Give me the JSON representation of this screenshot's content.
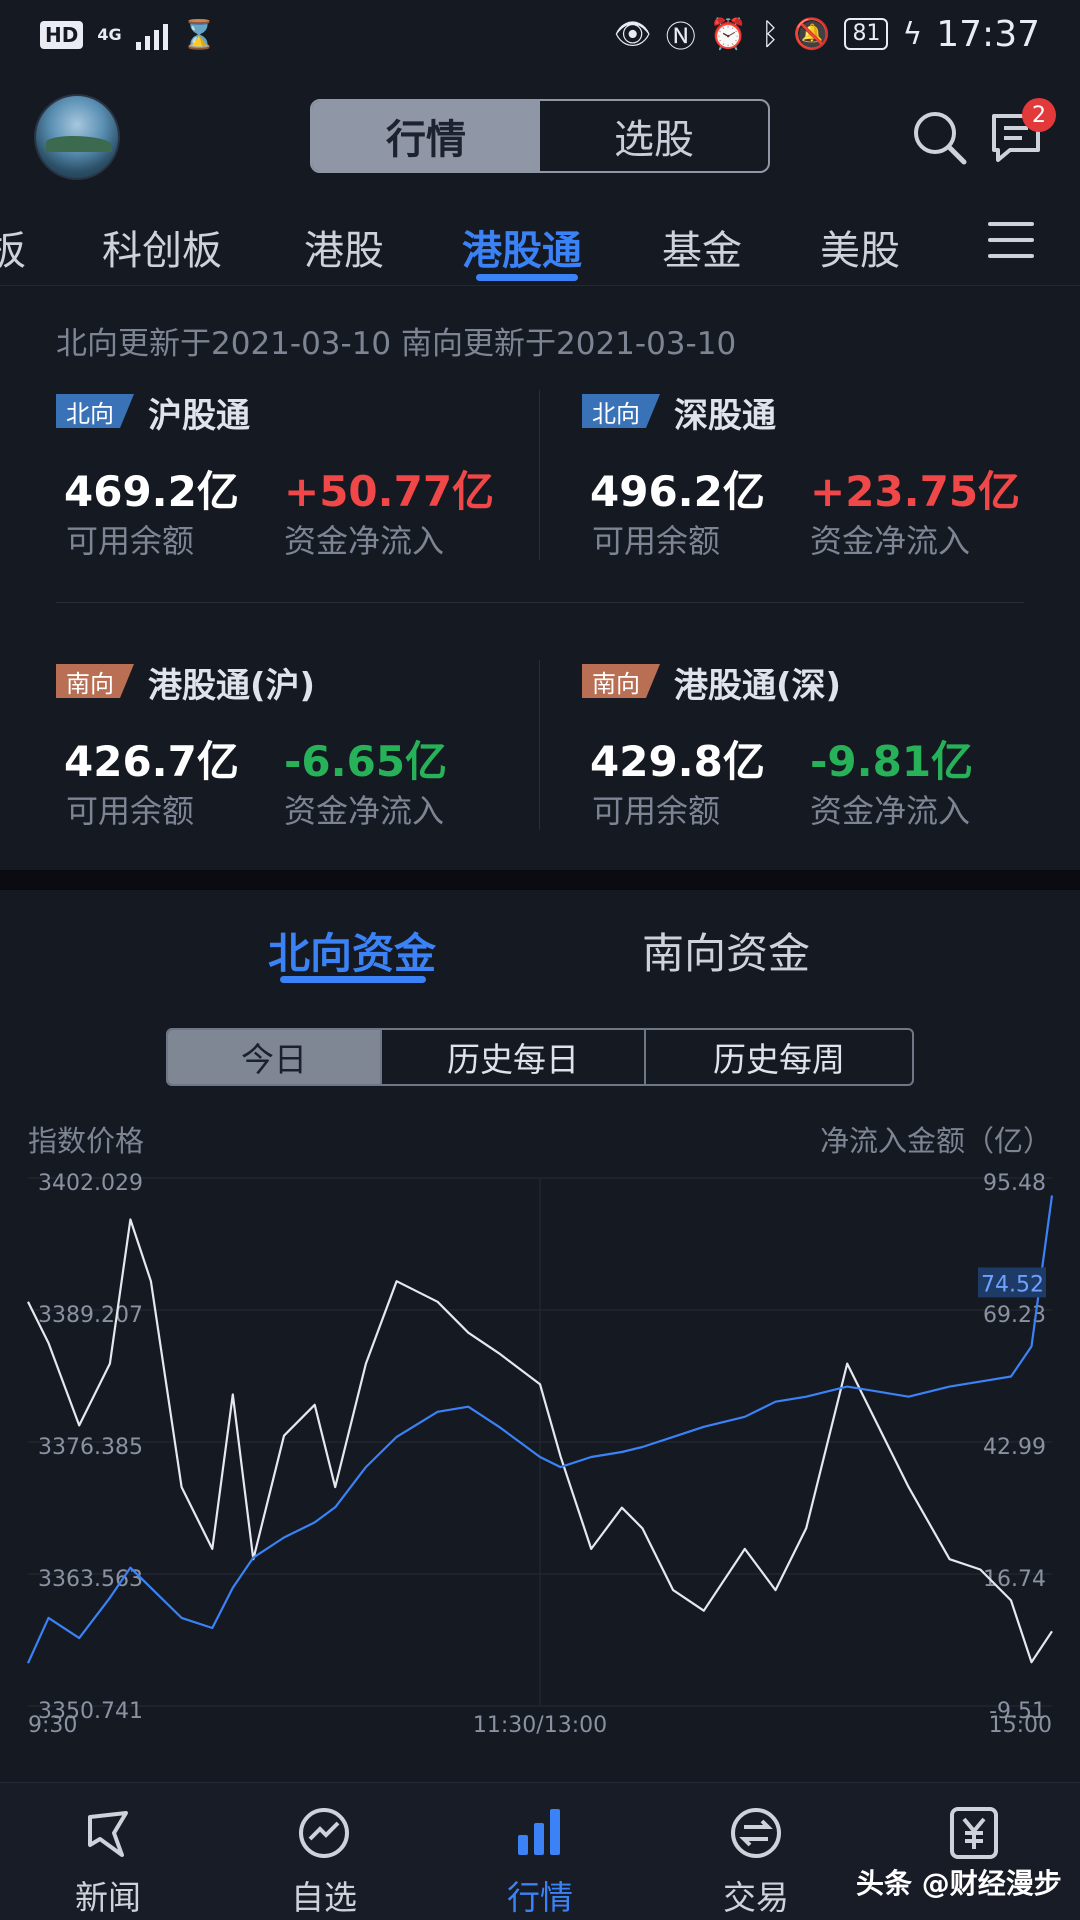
{
  "status_bar": {
    "hd": "HD",
    "network": "4G",
    "battery": "81",
    "time": "17:37"
  },
  "header": {
    "tabs": [
      {
        "label": "行情",
        "active": true
      },
      {
        "label": "选股",
        "active": false
      }
    ],
    "message_badge": "2"
  },
  "market_tabs": [
    {
      "label": "板",
      "active": false
    },
    {
      "label": "科创板",
      "active": false
    },
    {
      "label": "港股",
      "active": false
    },
    {
      "label": "港股通",
      "active": true
    },
    {
      "label": "基金",
      "active": false
    },
    {
      "label": "美股",
      "active": false
    }
  ],
  "update_line": "北向更新于2021-03-10  南向更新于2021-03-10",
  "cards": [
    {
      "tag": "北向",
      "title": "沪股通",
      "available": "469.2亿",
      "available_label": "可用余额",
      "net_flow": "+50.77亿",
      "net_flow_label": "资金净流入",
      "direction": "up"
    },
    {
      "tag": "北向",
      "title": "深股通",
      "available": "496.2亿",
      "available_label": "可用余额",
      "net_flow": "+23.75亿",
      "net_flow_label": "资金净流入",
      "direction": "up"
    },
    {
      "tag": "南向",
      "title": "港股通(沪)",
      "available": "426.7亿",
      "available_label": "可用余额",
      "net_flow": "-6.65亿",
      "net_flow_label": "资金净流入",
      "direction": "down"
    },
    {
      "tag": "南向",
      "title": "港股通(深)",
      "available": "429.8亿",
      "available_label": "可用余额",
      "net_flow": "-9.81亿",
      "net_flow_label": "资金净流入",
      "direction": "down"
    }
  ],
  "fund_tabs": [
    {
      "label": "北向资金",
      "active": true
    },
    {
      "label": "南向资金",
      "active": false
    }
  ],
  "range_tabs": [
    {
      "label": "今日",
      "active": true
    },
    {
      "label": "历史每日",
      "active": false
    },
    {
      "label": "历史每周",
      "active": false
    }
  ],
  "chart_data": {
    "type": "line",
    "ylabel_left": "指数价格",
    "ylabel_right": "净流入金额（亿）",
    "y_left_ticks": [
      "3402.029",
      "3389.207",
      "3376.385",
      "3363.563",
      "3350.741"
    ],
    "y_right_ticks": [
      "95.48",
      "69.23",
      "42.99",
      "16.74",
      "-9.51"
    ],
    "y_left_range": [
      3350.741,
      3402.029
    ],
    "y_right_range": [
      -9.51,
      95.48
    ],
    "x_ticks": [
      "9:30",
      "11:30/13:00",
      "15:00"
    ],
    "last_value_label": "74.52",
    "x": [
      0,
      0.02,
      0.05,
      0.08,
      0.1,
      0.12,
      0.15,
      0.18,
      0.2,
      0.22,
      0.25,
      0.28,
      0.3,
      0.33,
      0.36,
      0.4,
      0.43,
      0.46,
      0.5,
      0.52,
      0.55,
      0.58,
      0.6,
      0.63,
      0.66,
      0.7,
      0.73,
      0.76,
      0.8,
      0.83,
      0.86,
      0.9,
      0.93,
      0.96,
      0.98,
      1.0
    ],
    "series": [
      {
        "role": "index_price",
        "color": "#e6e8ee",
        "values": [
          3390,
          3386,
          3378,
          3384,
          3398,
          3392,
          3372,
          3366,
          3381,
          3365,
          3377,
          3380,
          3372,
          3384,
          3392,
          3390,
          3387,
          3385,
          3382,
          3375,
          3366,
          3370,
          3368,
          3362,
          3360,
          3366,
          3362,
          3368,
          3384,
          3378,
          3372,
          3365,
          3364,
          3361,
          3355,
          3358
        ]
      },
      {
        "role": "net_inflow",
        "color": "#3b82f6",
        "values": [
          -1,
          8,
          4,
          12,
          18,
          14,
          8,
          6,
          14,
          20,
          24,
          27,
          30,
          38,
          44,
          49,
          50,
          46,
          40,
          38,
          40,
          41,
          42,
          44,
          46,
          48,
          51,
          52,
          54,
          53,
          52,
          54,
          55,
          56,
          62,
          92
        ]
      }
    ]
  },
  "bottom_nav": [
    {
      "label": "新闻",
      "icon": "news-icon",
      "active": false
    },
    {
      "label": "自选",
      "icon": "watchlist-icon",
      "active": false
    },
    {
      "label": "行情",
      "icon": "market-icon",
      "active": true
    },
    {
      "label": "交易",
      "icon": "trade-icon",
      "active": false
    },
    {
      "label": "",
      "icon": "yuan-icon",
      "active": false
    }
  ],
  "watermark": "头条 @财经漫步"
}
